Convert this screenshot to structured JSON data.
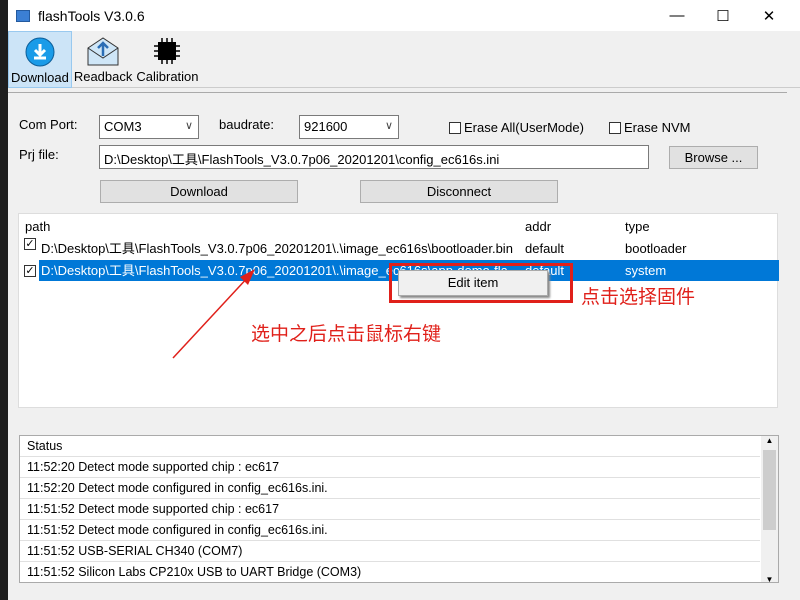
{
  "window": {
    "title": "flashTools V3.0.6",
    "minimize": "—",
    "maximize": "☐",
    "close": "✕"
  },
  "toolbar": [
    {
      "label": "Download",
      "icon": "download-icon"
    },
    {
      "label": "Readback",
      "icon": "envelope-upload-icon"
    },
    {
      "label": "Calibration",
      "icon": "chip-icon"
    }
  ],
  "form": {
    "com_port_label": "Com Port:",
    "com_port_value": "COM3",
    "baudrate_label": "baudrate:",
    "baudrate_value": "921600",
    "erase_all_label": "Erase All(UserMode)",
    "erase_nvm_label": "Erase NVM",
    "prj_label": "Prj file:",
    "prj_value": "D:\\Desktop\\工具\\FlashTools_V3.0.7p06_20201201\\config_ec616s.ini",
    "browse": "Browse ...",
    "download": "Download",
    "disconnect": "Disconnect"
  },
  "list": {
    "headers": [
      "path",
      "addr",
      "type"
    ],
    "rows": [
      {
        "path": "D:\\Desktop\\工具\\FlashTools_V3.0.7p06_20201201\\.\\image_ec616s\\bootloader.bin",
        "addr": "default",
        "type": "bootloader",
        "checked": true,
        "selected": false
      },
      {
        "path": "D:\\Desktop\\工具\\FlashTools_V3.0.7p06_20201201\\.\\image_ec616s\\app-demo-fla...",
        "addr": "default",
        "type": "system",
        "checked": true,
        "selected": true
      }
    ]
  },
  "context_menu": {
    "items": [
      "Edit item"
    ]
  },
  "annotations": {
    "click_firmware": "点击选择固件",
    "right_click_hint": "选中之后点击鼠标右键"
  },
  "status": {
    "header": "Status",
    "lines": [
      "11:52:20 Detect mode supported chip : ec617",
      "11:52:20 Detect mode configured in  config_ec616s.ini.",
      "11:51:52 Detect mode supported chip : ec617",
      "11:51:52 Detect mode configured in  config_ec616s.ini.",
      "11:51:52 USB-SERIAL CH340 (COM7)",
      "11:51:52 Silicon Labs CP210x USB to UART Bridge (COM3)"
    ]
  },
  "colors": {
    "selection": "#0078d7",
    "annotation": "#e0201a"
  }
}
